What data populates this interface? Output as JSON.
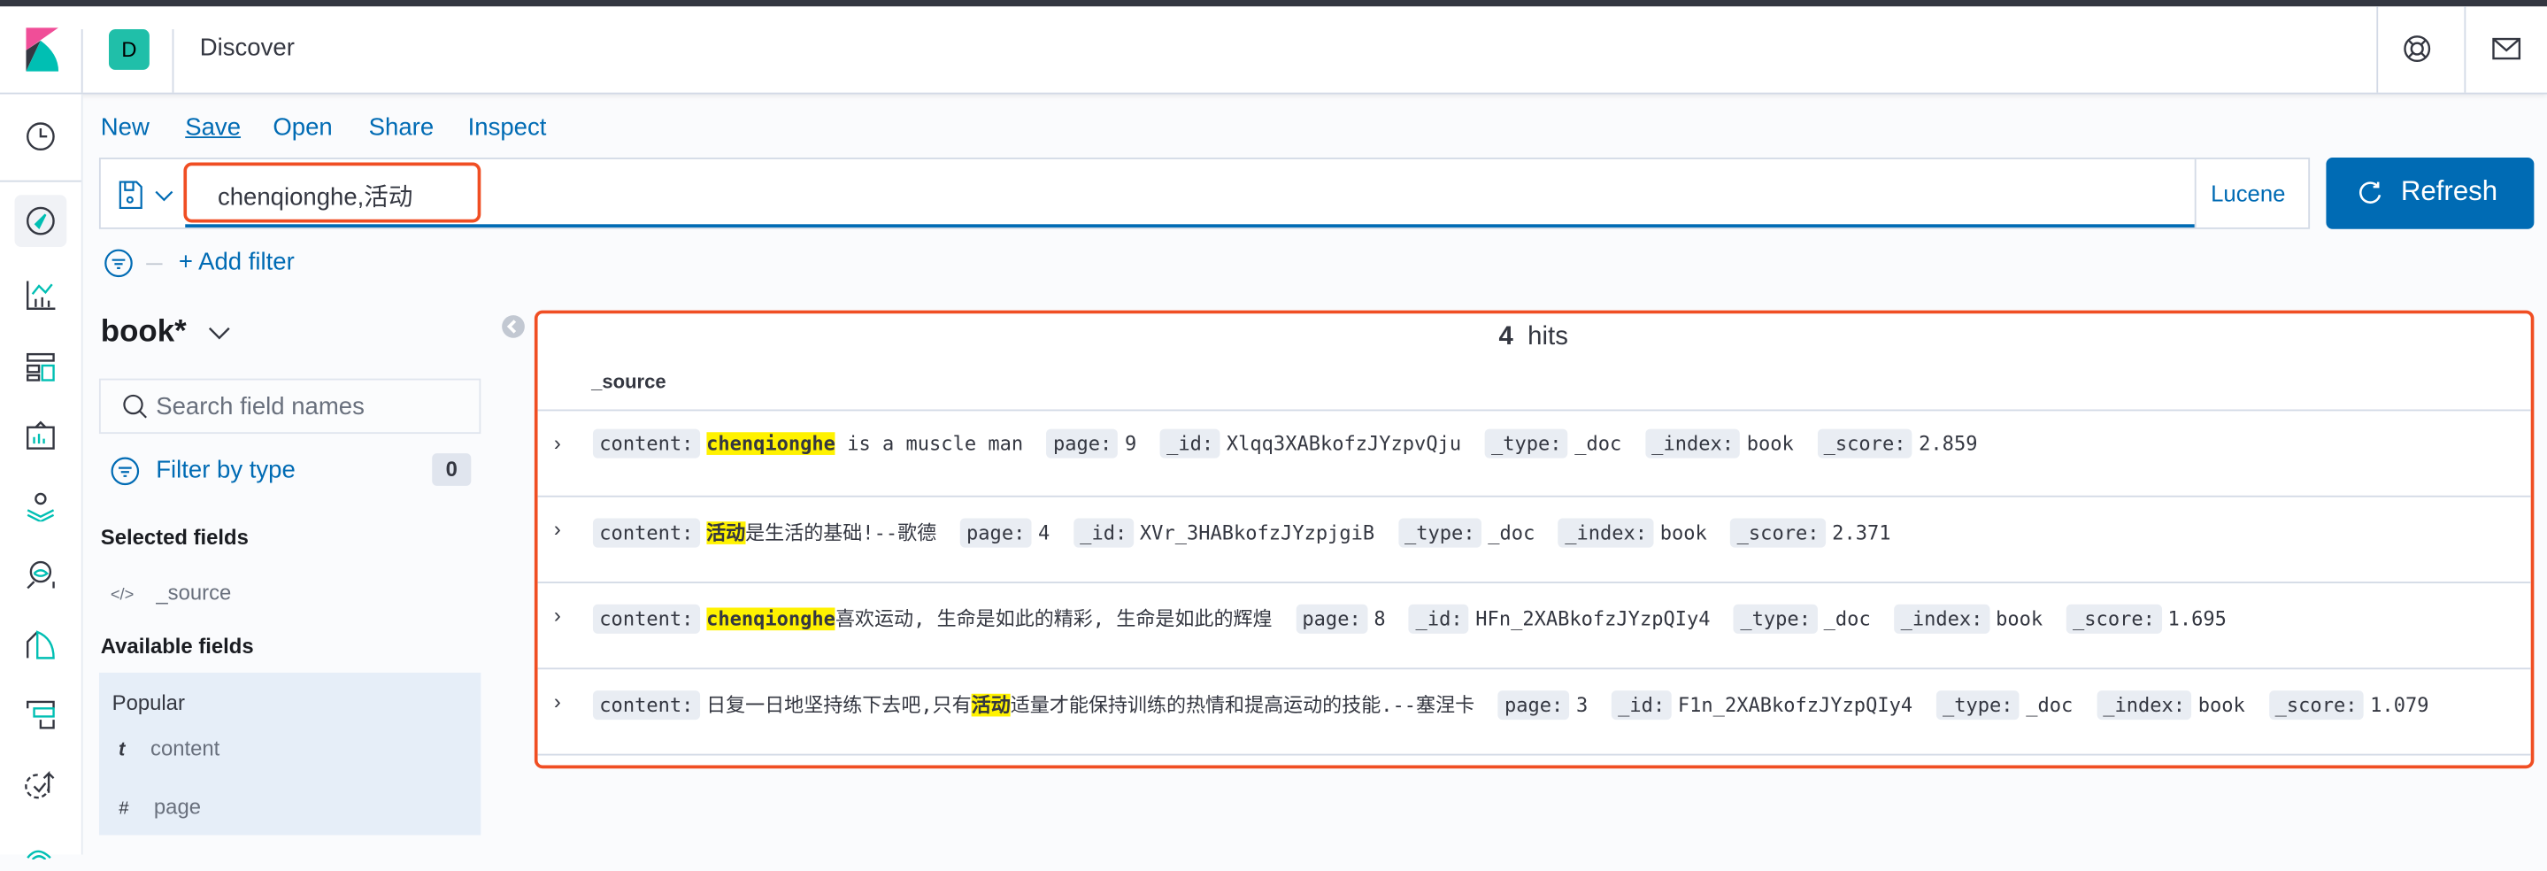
{
  "header": {
    "space_badge": "D",
    "app_title": "Discover",
    "help_icon": "lifebuoy-icon",
    "mail_icon": "mail-icon"
  },
  "nav_icons": [
    "clock-icon",
    "compass-icon",
    "visualize-icon",
    "dashboard-icon",
    "canvas-icon",
    "maps-icon",
    "ml-icon",
    "infrastructure-icon",
    "logs-icon",
    "uptime-icon",
    "apm-icon"
  ],
  "menu": {
    "new": "New",
    "save": "Save",
    "open": "Open",
    "share": "Share",
    "inspect": "Inspect"
  },
  "query": {
    "value": "chenqionghe,活动",
    "language": "Lucene",
    "refresh": "Refresh"
  },
  "filter": {
    "add": "+ Add filter"
  },
  "sidebar": {
    "index_pattern": "book*",
    "search_placeholder": "Search field names",
    "filter_by_type": "Filter by type",
    "filter_count": "0",
    "selected_title": "Selected fields",
    "selected": [
      {
        "type": "</>",
        "name": "_source"
      }
    ],
    "available_title": "Available fields",
    "popular_title": "Popular",
    "popular": [
      {
        "type": "t",
        "name": "content"
      },
      {
        "type": "#",
        "name": "page"
      }
    ]
  },
  "results": {
    "hits_count": "4",
    "hits_label": "hits",
    "column": "_source",
    "rows": [
      {
        "pre": "",
        "hl": "chenqionghe",
        "post": " is a muscle man",
        "page": "9",
        "id": "Xlqq3XABkofzJYzpvQju",
        "type": "_doc",
        "index": "book",
        "score": "2.859"
      },
      {
        "pre": "",
        "hl": "活动",
        "post": "是生活的基础!--歌德",
        "page": "4",
        "id": "XVr_3HABkofzJYzpjgiB",
        "type": "_doc",
        "index": "book",
        "score": "2.371"
      },
      {
        "pre": "",
        "hl": "chenqionghe",
        "post": "喜欢运动, 生命是如此的精彩, 生命是如此的辉煌",
        "page": "8",
        "id": "HFn_2XABkofzJYzpQIy4",
        "type": "_doc",
        "index": "book",
        "score": "1.695"
      },
      {
        "pre": "日复一日地坚持练下去吧,只有",
        "hl": "活动",
        "post": "适量才能保持训练的热情和提高运动的技能.--塞涅卡",
        "page": "3",
        "id": "F1n_2XABkofzJYzpQIy4",
        "type": "_doc",
        "index": "book",
        "score": "1.079"
      }
    ],
    "labels": {
      "content": "content:",
      "page": "page:",
      "id": "_id:",
      "type": "_type:",
      "index": "_index:",
      "score": "_score:"
    }
  },
  "colors": {
    "accent": "#006bb4",
    "highlight": "#fff200",
    "annotation": "#f04e23"
  }
}
